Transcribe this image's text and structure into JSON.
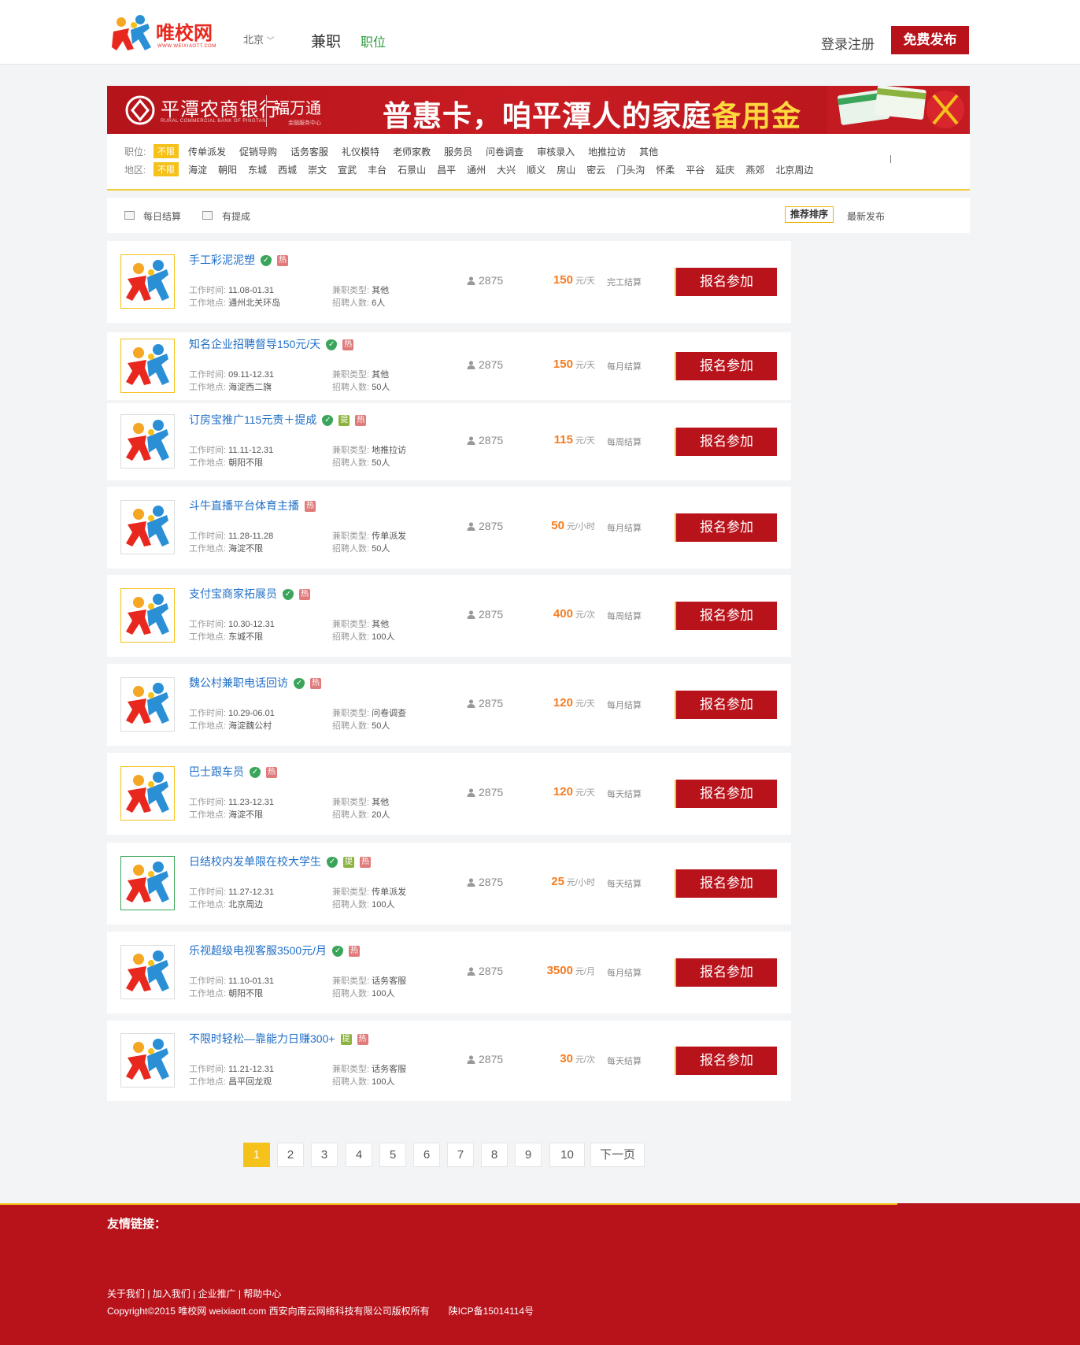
{
  "header": {
    "logo_text": "唯校网",
    "logo_sub": "WWW.WEIXIAOTT.COM",
    "city": "北京",
    "nav_parttime": "兼职",
    "nav_position": "职位",
    "login": "登录注册",
    "publish": "免费发布"
  },
  "banner": {
    "bank_name": "平潭农商银行",
    "bank_sub": "RURAL COMMERCIAL BANK OF PINGTAN",
    "brand": "福万通",
    "brand_sub": "金融服务中心",
    "slogan_main": "普惠卡，咱平潭人的家庭",
    "slogan_highlight": "备用金"
  },
  "filter": {
    "position_label": "职位:",
    "area_label": "地区:",
    "selected": "不限",
    "positions": [
      "传单派发",
      "促销导购",
      "话务客服",
      "礼仪模特",
      "老师家教",
      "服务员",
      "问卷调查",
      "审核录入",
      "地推拉访",
      "其他"
    ],
    "areas": [
      "海淀",
      "朝阳",
      "东城",
      "西城",
      "崇文",
      "宣武",
      "丰台",
      "石景山",
      "昌平",
      "通州",
      "大兴",
      "顺义",
      "房山",
      "密云",
      "门头沟",
      "怀柔",
      "平谷",
      "延庆",
      "燕郊",
      "北京周边"
    ]
  },
  "sortbar": {
    "daily_settle": "每日结算",
    "commission": "有提成",
    "sort_recommended": "推荐排序",
    "sort_newest": "最新发布"
  },
  "labels": {
    "work_time": "工作时间:",
    "work_place": "工作地点:",
    "job_type": "兼职类型:",
    "headcount": "招聘人数:",
    "apply": "报名参加"
  },
  "jobs": [
    {
      "title": "手工彩泥泥塑",
      "badges": [
        "shield",
        "re"
      ],
      "time": "11.08-01.31",
      "place": "通州北关环岛",
      "type": "其他",
      "count": "6人",
      "views": "2875",
      "pay": "150",
      "unit": "元/天",
      "settle": "完工结算"
    },
    {
      "title": "知名企业招聘督导150元/天",
      "badges": [
        "shield",
        "re"
      ],
      "time": "09.11-12.31",
      "place": "海淀西二旗",
      "type": "其他",
      "count": "50人",
      "views": "2875",
      "pay": "150",
      "unit": "元/天",
      "settle": "每月结算"
    },
    {
      "title": "订房宝推广115元责＋提成",
      "badges": [
        "shield",
        "ti",
        "re"
      ],
      "time": "11.11-12.31",
      "place": "朝阳不限",
      "type": "地推拉访",
      "count": "50人",
      "views": "2875",
      "pay": "115",
      "unit": "元/天",
      "settle": "每周结算"
    },
    {
      "title": "斗牛直播平台体育主播",
      "badges": [
        "re"
      ],
      "time": "11.28-11.28",
      "place": "海淀不限",
      "type": "传单派发",
      "count": "50人",
      "views": "2875",
      "pay": "50",
      "unit": "元/小时",
      "settle": "每月结算"
    },
    {
      "title": "支付宝商家拓展员",
      "badges": [
        "shield",
        "re"
      ],
      "time": "10.30-12.31",
      "place": "东城不限",
      "type": "其他",
      "count": "100人",
      "views": "2875",
      "pay": "400",
      "unit": "元/次",
      "settle": "每周结算"
    },
    {
      "title": "魏公村兼职电话回访",
      "badges": [
        "shield",
        "re"
      ],
      "time": "10.29-06.01",
      "place": "海淀魏公村",
      "type": "问卷调查",
      "count": "50人",
      "views": "2875",
      "pay": "120",
      "unit": "元/天",
      "settle": "每月结算"
    },
    {
      "title": "巴士跟车员",
      "badges": [
        "shield",
        "re"
      ],
      "time": "11.23-12.31",
      "place": "海淀不限",
      "type": "其他",
      "count": "20人",
      "views": "2875",
      "pay": "120",
      "unit": "元/天",
      "settle": "每天结算"
    },
    {
      "title": "日结校内发单限在校大学生",
      "badges": [
        "shield",
        "ti",
        "re"
      ],
      "time": "11.27-12.31",
      "place": "北京周边",
      "type": "传单派发",
      "count": "100人",
      "views": "2875",
      "pay": "25",
      "unit": "元/小时",
      "settle": "每天结算"
    },
    {
      "title": "乐视超级电视客服3500元/月",
      "badges": [
        "shield",
        "re"
      ],
      "time": "11.10-01.31",
      "place": "朝阳不限",
      "type": "话务客服",
      "count": "100人",
      "views": "2875",
      "pay": "3500",
      "unit": "元/月",
      "settle": "每月结算"
    },
    {
      "title": "不限时轻松—靠能力日赚300+",
      "badges": [
        "ti",
        "re"
      ],
      "time": "11.21-12.31",
      "place": "昌平回龙观",
      "type": "话务客服",
      "count": "100人",
      "views": "2875",
      "pay": "30",
      "unit": "元/次",
      "settle": "每天结算"
    }
  ],
  "badge_text": {
    "shield": "✓",
    "ti": "提",
    "re": "热"
  },
  "pagination": {
    "pages": [
      "1",
      "2",
      "3",
      "4",
      "5",
      "6",
      "7",
      "8",
      "9",
      "10"
    ],
    "current": "1",
    "next": "下一页"
  },
  "footer": {
    "friend_links": "友情链接：",
    "links": "关于我们 | 加入我们 | 企业推广 | 帮助中心",
    "copyright": "Copyright©2015 唯校网 weixiaott.com 西安向南云网络科技有限公司版权所有　　陕ICP备15014114号"
  },
  "colors": {
    "brand_red": "#b8121b",
    "accent_yellow": "#f5c21b",
    "link_blue": "#1f6fc8",
    "pay_orange": "#f47b20",
    "nav_green": "#2e9a3f"
  }
}
